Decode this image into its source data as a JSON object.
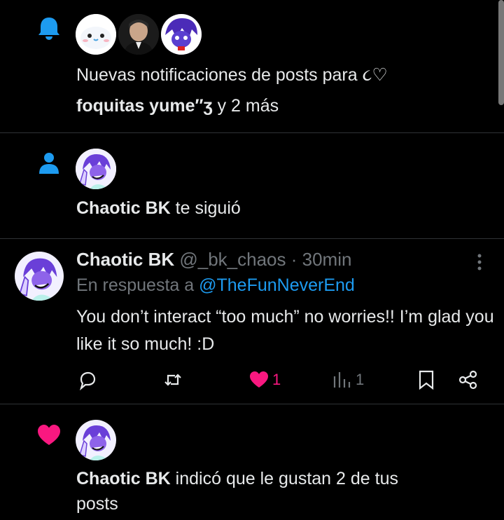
{
  "notifications": [
    {
      "type": "bell-icon",
      "text_plain": "Nuevas notificaciones de posts para ",
      "text_emoji": "૮♡",
      "names_bold": "foquitas yume",
      "names_suffix": "″ʒ",
      "text_after": " y 2 más"
    },
    {
      "type": "person-icon",
      "name": "Chaotic BK",
      "text": " te siguió"
    },
    {
      "type": "heart-icon",
      "name": "Chaotic BK",
      "text": " indicó que le gustan 2 de tus",
      "text_line2": "posts"
    }
  ],
  "post": {
    "display_name": "Chaotic BK",
    "handle": "@_bk_chaos",
    "separator": " · ",
    "time": "30min",
    "reply_prefix": "En respuesta a ",
    "reply_to": "@TheFunNeverEnd",
    "body": "You don’t interact “too much” no worries!! I’m glad you like it so much! :D",
    "actions": {
      "reply_icon": "reply-icon",
      "repost_icon": "repost-icon",
      "like_icon": "heart-icon",
      "like_count": "1",
      "views_icon": "views-icon",
      "views_count": "1",
      "bookmark_icon": "bookmark-icon",
      "share_icon": "share-icon"
    }
  },
  "colors": {
    "background": "#000000",
    "text": "#e7e9ea",
    "muted": "#71767b",
    "accent": "#1d9bf0",
    "like": "#f91880",
    "divider": "#2f3336"
  }
}
